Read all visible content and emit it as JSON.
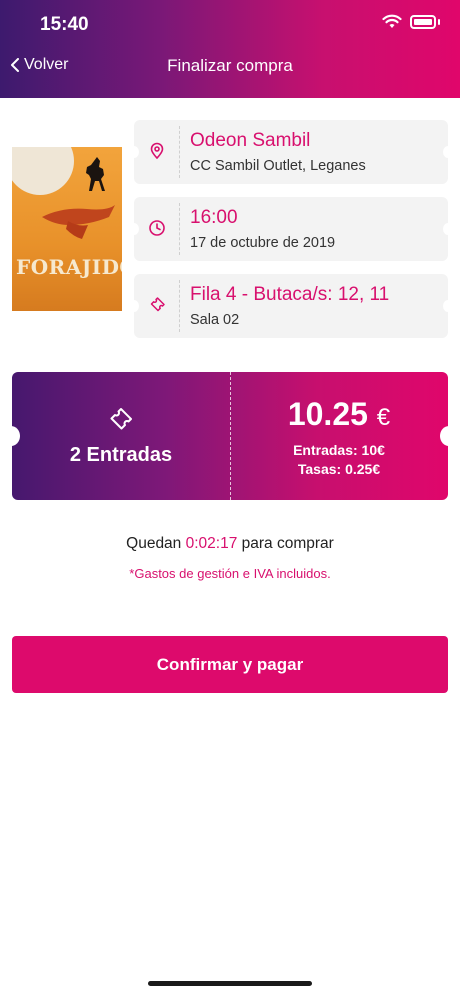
{
  "status_bar": {
    "time": "15:40"
  },
  "header": {
    "back_label": "Volver",
    "title": "Finalizar compra"
  },
  "poster": {
    "title": "FORAJIDOS"
  },
  "cards": [
    {
      "icon": "location-pin-icon",
      "primary": "Odeon Sambil",
      "secondary": "CC Sambil Outlet, Leganes"
    },
    {
      "icon": "clock-icon",
      "primary": "16:00",
      "secondary": "17 de octubre de 2019"
    },
    {
      "icon": "ticket-icon",
      "primary": "Fila 4 - Butaca/s: 12, 11",
      "secondary": "Sala 02"
    }
  ],
  "ticket": {
    "count_label": "2 Entradas",
    "price": "10.25",
    "currency": "€",
    "entradas_label": "Entradas: 10€",
    "tasas_label": "Tasas: 0.25€"
  },
  "remaining": {
    "prefix": "Quedan",
    "timer": "0:02:17",
    "suffix": "para comprar"
  },
  "note": "*Gastos de gestión e IVA incluidos.",
  "confirm_label": "Confirmar y pagar",
  "colors": {
    "accent": "#dd0a6c",
    "header_start": "#3d1a6e",
    "header_end": "#e0066b"
  }
}
